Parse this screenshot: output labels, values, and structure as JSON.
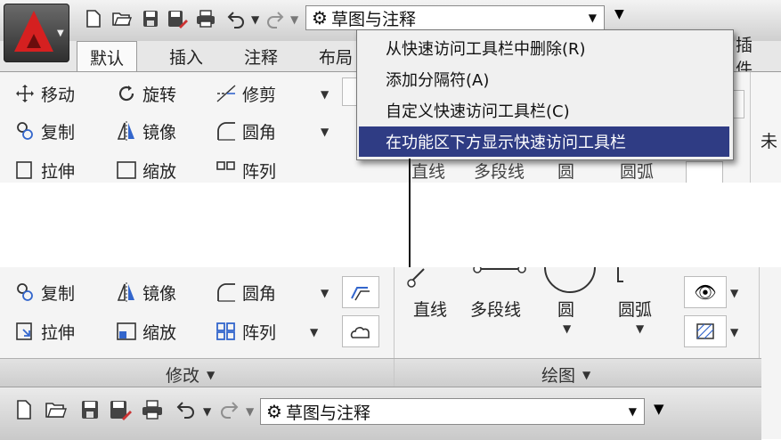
{
  "quick_access": {
    "workspace": "草图与注释",
    "icons": [
      "new-icon",
      "open-icon",
      "save-icon",
      "saveas-icon",
      "print-icon",
      "undo-icon",
      "redo-icon",
      "gear-icon"
    ]
  },
  "tabs": [
    "默认",
    "插入",
    "注释",
    "布局"
  ],
  "tab_clipped_right": "插件",
  "context_menu": {
    "items": [
      {
        "label": "从快速访问工具栏中删除(R)",
        "selected": false
      },
      {
        "label": "添加分隔符(A)",
        "selected": false
      },
      {
        "label": "自定义快速访问工具栏(C)",
        "selected": false
      },
      {
        "label": "在功能区下方显示快速访问工具栏",
        "selected": true
      }
    ]
  },
  "modify_panel": {
    "title": "修改",
    "tools": {
      "move": "移动",
      "rotate": "旋转",
      "trim": "修剪",
      "copy": "复制",
      "mirror": "镜像",
      "fillet": "圆角",
      "stretch": "拉伸",
      "scale": "缩放",
      "array": "阵列"
    }
  },
  "draw_panel": {
    "title": "绘图",
    "tools": {
      "line": "直线",
      "polyline": "多段线",
      "circle": "圆",
      "arc": "圆弧"
    }
  },
  "right_clipped": {
    "row1": "",
    "row2": "未"
  },
  "colors": {
    "menu_highlight": "#2f3c84",
    "logo_red": "#d52020",
    "qat_bg": "#d8d8d8"
  }
}
